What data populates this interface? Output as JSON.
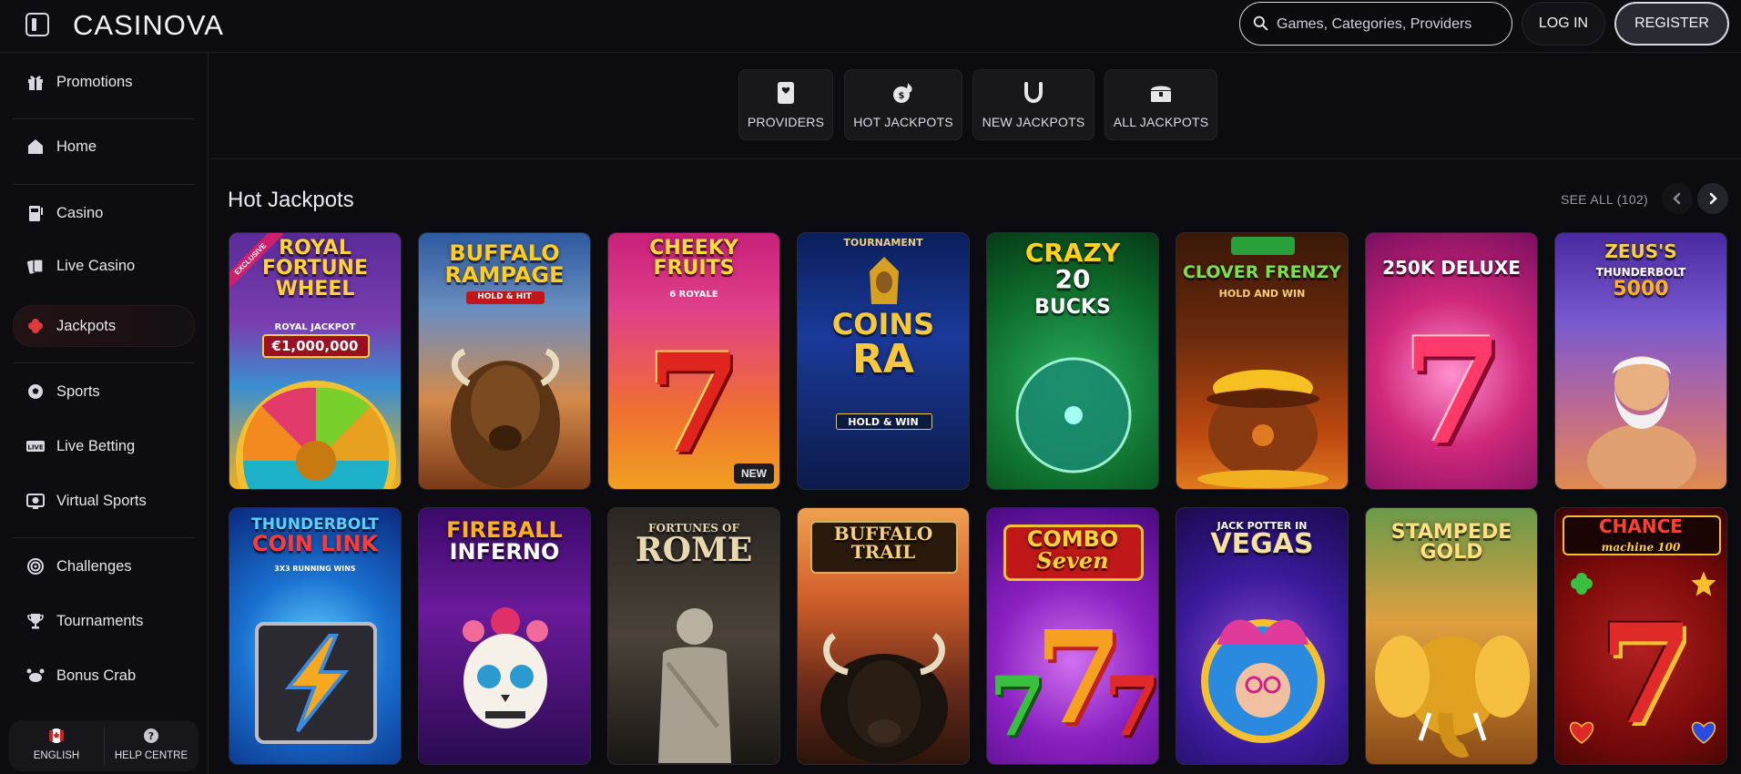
{
  "header": {
    "logo": "CASINOVA",
    "search_placeholder": "Games, Categories, Providers",
    "login_label": "LOG IN",
    "register_label": "REGISTER"
  },
  "sidebar": {
    "items": [
      {
        "label": "Promotions",
        "icon": "gift-icon"
      },
      {
        "label": "Home",
        "icon": "home-icon"
      },
      {
        "label": "Casino",
        "icon": "slot-machine-icon"
      },
      {
        "label": "Live Casino",
        "icon": "cards-icon"
      },
      {
        "label": "Jackpots",
        "icon": "clover-icon",
        "active": true
      },
      {
        "label": "Sports",
        "icon": "soccer-ball-icon"
      },
      {
        "label": "Live Betting",
        "icon": "live-icon"
      },
      {
        "label": "Virtual Sports",
        "icon": "virtual-sports-icon"
      },
      {
        "label": "Challenges",
        "icon": "target-icon"
      },
      {
        "label": "Tournaments",
        "icon": "trophy-icon"
      },
      {
        "label": "Bonus Crab",
        "icon": "crab-icon"
      }
    ],
    "bottom": {
      "language_label": "ENGLISH",
      "help_label": "HELP CENTRE"
    }
  },
  "categories": [
    {
      "label": "PROVIDERS",
      "icon": "providers-icon"
    },
    {
      "label": "HOT JACKPOTS",
      "icon": "hot-jackpot-icon"
    },
    {
      "label": "NEW JACKPOTS",
      "icon": "horseshoe-icon"
    },
    {
      "label": "ALL JACKPOTS",
      "icon": "treasure-chest-icon"
    }
  ],
  "section": {
    "title": "Hot Jackpots",
    "see_all": "SEE ALL (102)"
  },
  "games_row1": [
    {
      "title": "ROYAL FORTUNE WHEEL",
      "line1": "ROYAL",
      "line2": "FORTUNE",
      "line3": "WHEEL",
      "jackpot_label": "ROYAL JACKPOT",
      "jackpot_value": "€1,000,000",
      "ribbon": "EXCLUSIVE"
    },
    {
      "title": "BUFFALO RAMPAGE",
      "line1": "BUFFALO",
      "line2": "RAMPAGE",
      "sub": "HOLD & HIT"
    },
    {
      "title": "CHEEKY FRUITS 6 ROYALE",
      "line1": "CHEEKY",
      "line2": "FRUITS",
      "sub": "6 ROYALE",
      "badge": "NEW"
    },
    {
      "title": "COINS OF RA",
      "top": "TOURNAMENT",
      "line1": "COINS",
      "line2": "RA",
      "sub": "HOLD & WIN"
    },
    {
      "title": "CRAZY 20 BUCKS",
      "line1": "CRAZY",
      "line2": "20",
      "line3": "BUCKS"
    },
    {
      "title": "CLOVER FRENZY",
      "line1": "CLOVER FRENZY",
      "sub": "HOLD AND WIN"
    },
    {
      "title": "250K DELUXE",
      "line1": "250K DELUXE"
    },
    {
      "title": "ZEUS'S THUNDERBOLT 5000",
      "line1": "ZEUS'S",
      "line2": "THUNDERBOLT",
      "line3": "5000"
    }
  ],
  "games_row2": [
    {
      "title": "THUNDERBOLT COIN LINK",
      "line1": "THUNDERBOLT",
      "line2": "COIN LINK",
      "sub": "3X3 RUNNING WINS"
    },
    {
      "title": "FIREBALL INFERNO",
      "line1": "FIREBALL",
      "line2": "INFERNO"
    },
    {
      "title": "FORTUNES OF ROME",
      "line1": "FORTUNES OF",
      "line2": "ROME"
    },
    {
      "title": "BUFFALO TRAIL",
      "line1": "BUFFALO",
      "line2": "TRAIL"
    },
    {
      "title": "COMBO SEVEN",
      "line1": "COMBO",
      "line2": "Seven"
    },
    {
      "title": "JACK POTTER IN VEGAS",
      "line1": "JACK POTTER IN",
      "line2": "VEGAS"
    },
    {
      "title": "STAMPEDE GOLD",
      "line1": "STAMPEDE",
      "line2": "GOLD"
    },
    {
      "title": "CHANCE MACHINE 100",
      "line1": "CHANCE",
      "line2": "machine 100"
    }
  ]
}
